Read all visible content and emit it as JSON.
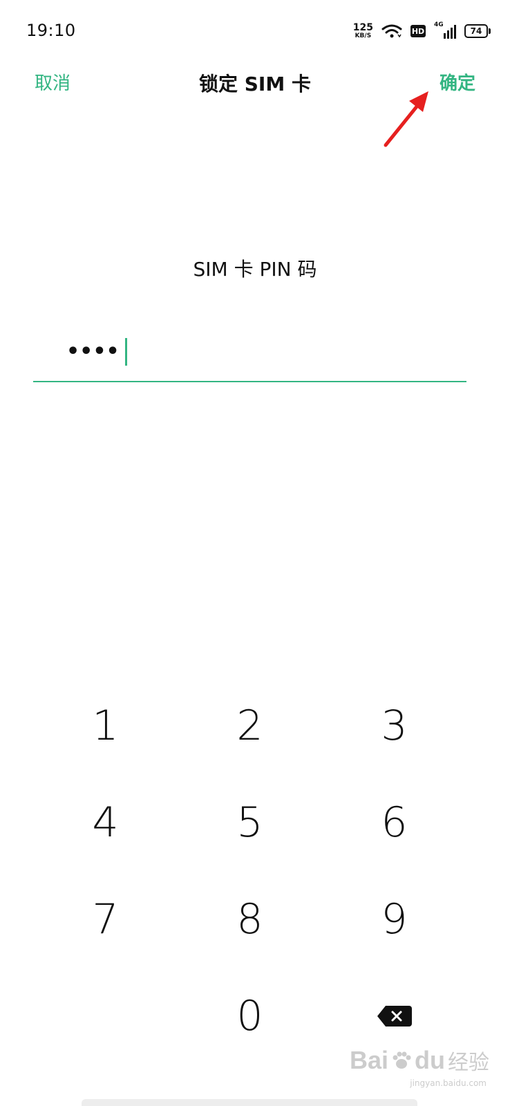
{
  "status_bar": {
    "time": "19:10",
    "net_speed": "125",
    "net_speed_unit": "KB/S",
    "hd_badge": "HD",
    "network_type": "4G",
    "battery": "74"
  },
  "navbar": {
    "cancel_label": "取消",
    "title": "锁定 SIM 卡",
    "confirm_label": "确定"
  },
  "form": {
    "pin_label": "SIM 卡 PIN 码",
    "pin_value": "••••"
  },
  "keypad": {
    "keys": [
      "1",
      "2",
      "3",
      "4",
      "5",
      "6",
      "7",
      "8",
      "9",
      "0"
    ],
    "backspace_icon": "backspace-icon"
  },
  "watermark": {
    "brand": "Bai",
    "brand2": "du",
    "cn": "经验",
    "url": "jingyan.baidu.com"
  },
  "colors": {
    "accent": "#33b582",
    "arrow": "#e6201f"
  }
}
